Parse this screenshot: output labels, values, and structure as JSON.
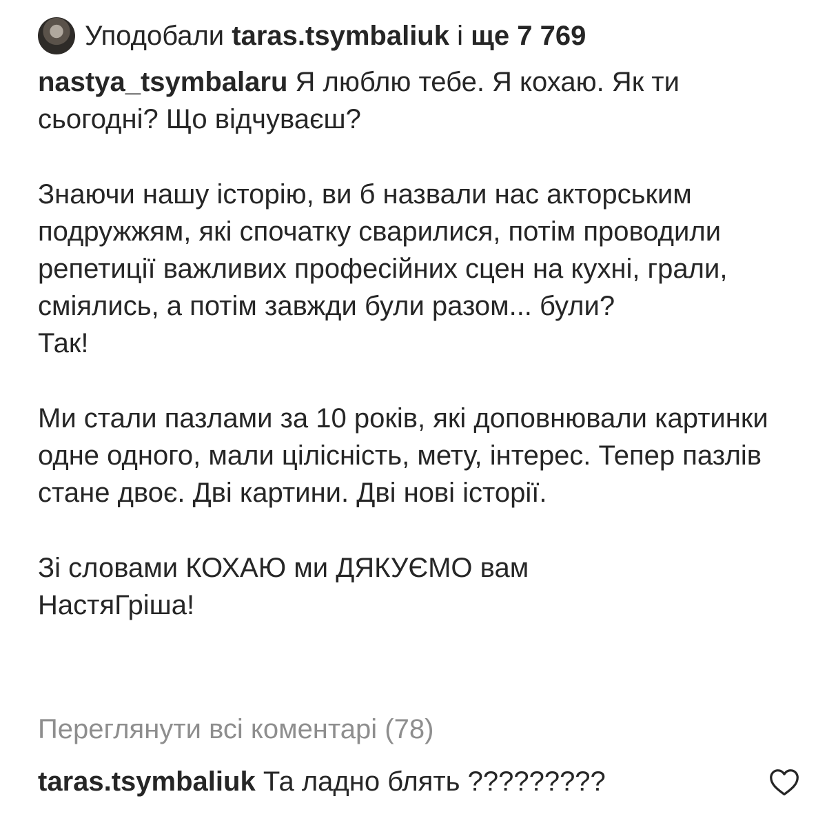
{
  "likes": {
    "prefix": "Уподобали",
    "user": "taras.tsymbaliuk",
    "connector": "і",
    "count_text": "ще 7 769"
  },
  "post": {
    "author": "nastya_tsymbalaru",
    "paragraphs": [
      "Я люблю тебе. Я кохаю. Як ти сьогодні? Що відчуваєш?",
      "Знаючи нашу історію, ви б назвали нас акторським подружжям, які спочатку сварилися, потім проводили репетиції важливих професійних сцен на кухні, грали, сміялись, а потім завжди були разом... були?",
      "Так!",
      "Ми стали пазлами за 10 років, які доповнювали картинки одне одного, мали цілісність, мету, інтерес. Тепер пазлів стане двоє. Дві картини. Дві нові історії.",
      "Зі словами КОХАЮ ми ДЯКУЄМО вам",
      "НастяГріша!"
    ]
  },
  "comments": {
    "view_all_label": "Переглянути всі коментарі (78)",
    "items": [
      {
        "user": "taras.tsymbaliuk",
        "text": "Та ладно блять ?????????"
      }
    ]
  },
  "icons": {
    "avatar": "user-avatar",
    "like": "heart-icon"
  }
}
